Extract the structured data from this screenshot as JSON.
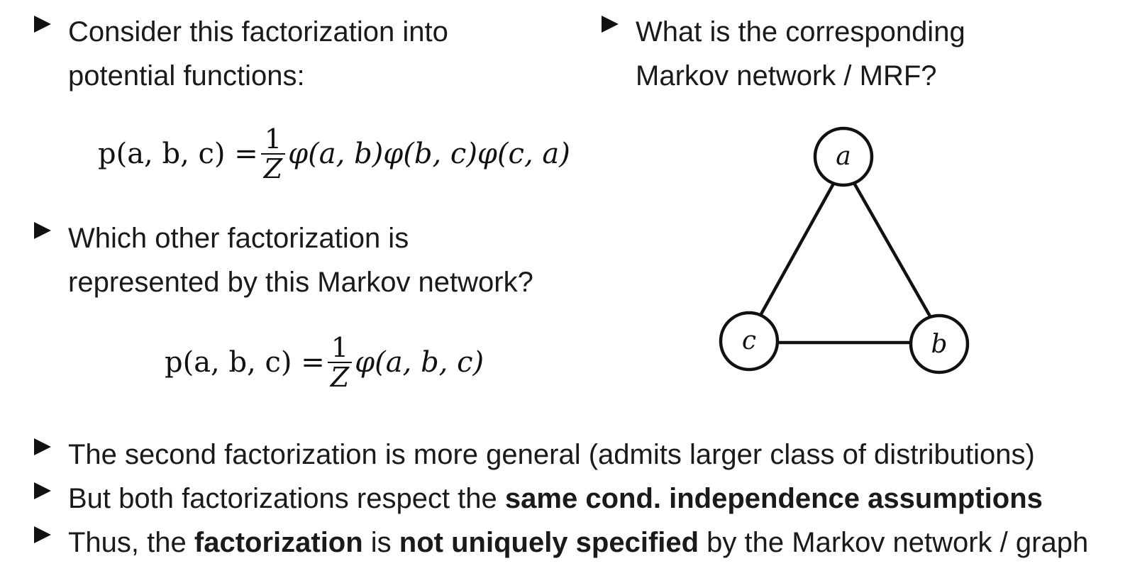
{
  "left_column": {
    "bullet1_line1": "Consider this factorization into",
    "bullet1_line2": "potential functions:",
    "formula1": {
      "lhs": "p(a, b, c) =",
      "frac_num": "1",
      "frac_den": "Z",
      "rhs": "φ(a, b)φ(b, c)φ(c, a)"
    },
    "bullet2_line1": "Which other factorization is",
    "bullet2_line2": "represented by this Markov network?",
    "formula2": {
      "lhs": "p(a, b, c) =",
      "frac_num": "1",
      "frac_den": "Z",
      "rhs": "φ(a, b, c)"
    }
  },
  "right_column": {
    "bullet_line1": "What is the corresponding",
    "bullet_line2": "Markov network / MRF?"
  },
  "graph": {
    "nodes": [
      {
        "id": "a",
        "label": "a"
      },
      {
        "id": "b",
        "label": "b"
      },
      {
        "id": "c",
        "label": "c"
      }
    ],
    "edges": [
      [
        "a",
        "c"
      ],
      [
        "a",
        "b"
      ],
      [
        "c",
        "b"
      ]
    ]
  },
  "bottom": {
    "line1": "The second factorization is more general (admits larger class of distributions)",
    "line2_pre": "But both factorizations respect the ",
    "line2_bold": "same cond. independence assumptions",
    "line3_pre": "Thus, the ",
    "line3_bold1": "factorization",
    "line3_mid": " is ",
    "line3_bold2": "not uniquely specified",
    "line3_post": " by the Markov network / graph"
  }
}
